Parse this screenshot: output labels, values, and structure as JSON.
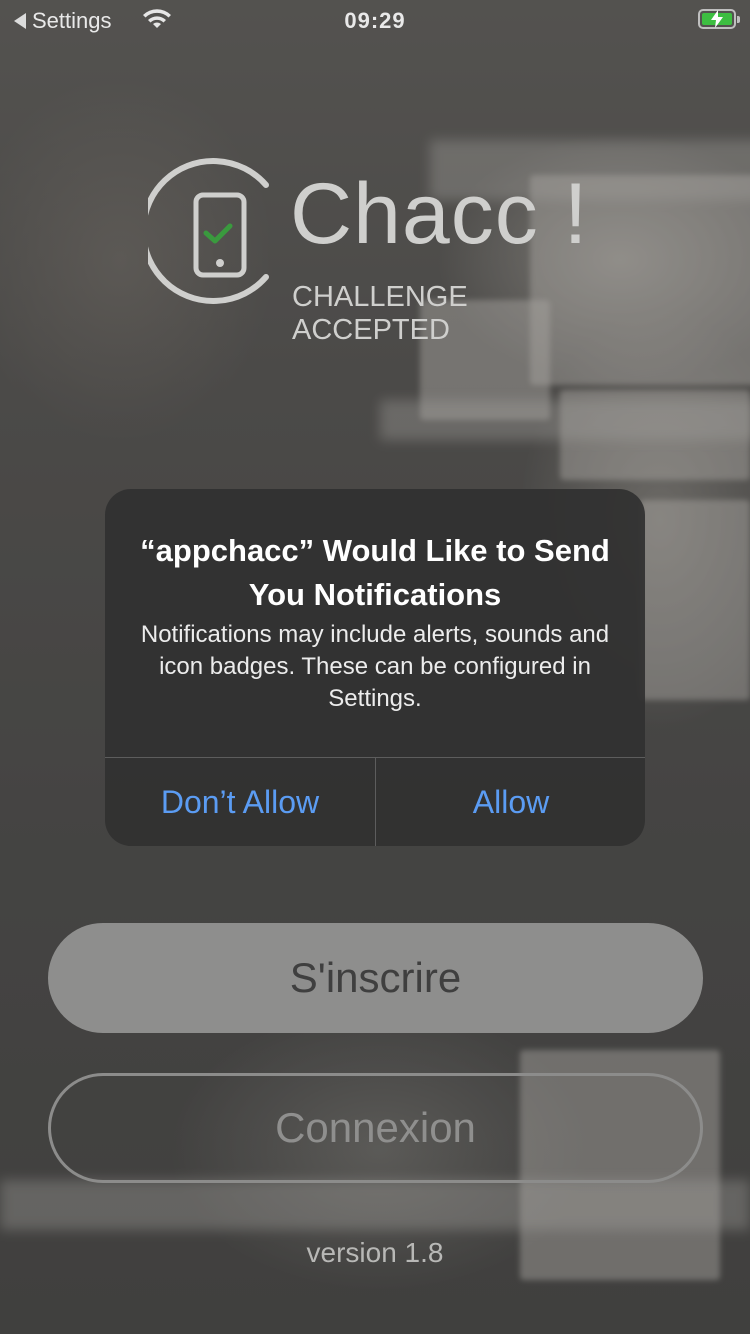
{
  "status_bar": {
    "back_label": "Settings",
    "time": "09:29",
    "battery_color": "#3dbe41"
  },
  "logo": {
    "brand": "Chacc !",
    "tagline": "CHALLENGE ACCEPTED",
    "check_color": "#3a9a3e"
  },
  "alert": {
    "title": "“appchacc” Would Like to Send You Notifications",
    "message": "Notifications may include alerts, sounds and icon badges. These can be configured in Settings.",
    "dont_allow_label": "Don’t Allow",
    "allow_label": "Allow",
    "button_color": "#5b9cf3"
  },
  "actions": {
    "signup_label": "S'inscrire",
    "login_label": "Connexion"
  },
  "footer": {
    "version": "version 1.8"
  }
}
